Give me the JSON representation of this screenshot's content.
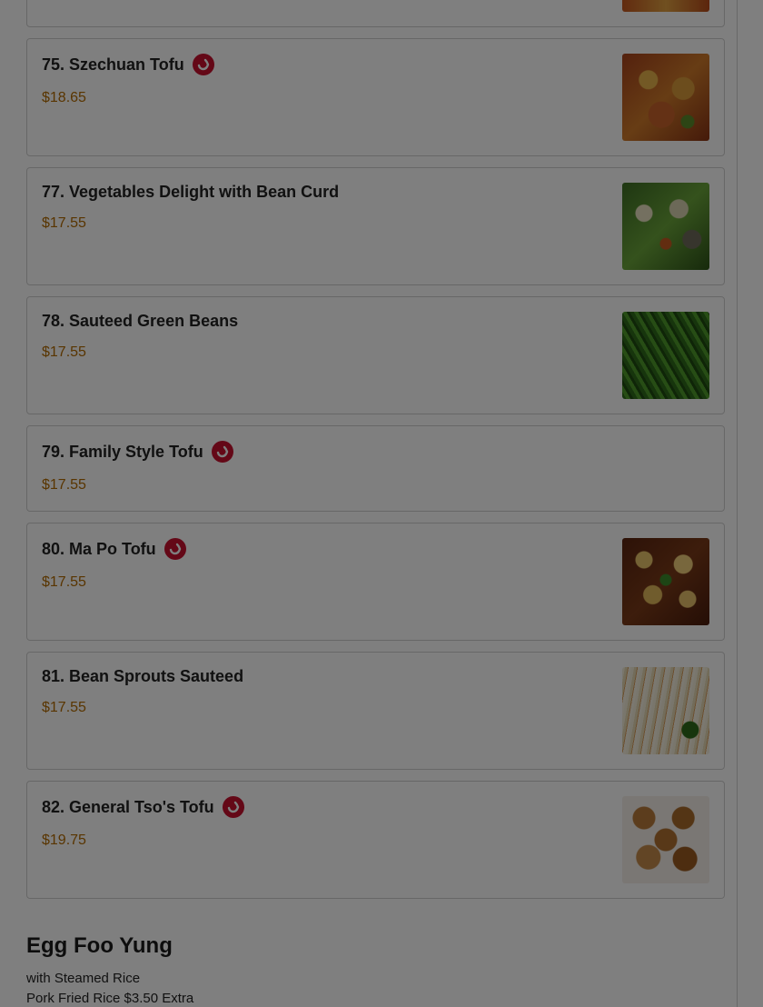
{
  "menu": {
    "items": [
      {
        "number_name": "75. Szechuan Tofu",
        "price": "$18.65",
        "spicy": true,
        "has_image": true,
        "food_icon": "stir-fry-tofu-photo"
      },
      {
        "number_name": "77. Vegetables Delight with Bean Curd",
        "price": "$17.55",
        "spicy": false,
        "has_image": true,
        "food_icon": "vegetables-photo"
      },
      {
        "number_name": "78. Sauteed Green Beans",
        "price": "$17.55",
        "spicy": false,
        "has_image": true,
        "food_icon": "green-beans-photo"
      },
      {
        "number_name": "79. Family Style Tofu",
        "price": "$17.55",
        "spicy": true,
        "has_image": false
      },
      {
        "number_name": "80. Ma Po Tofu",
        "price": "$17.55",
        "spicy": true,
        "has_image": true,
        "food_icon": "mapo-tofu-photo"
      },
      {
        "number_name": "81. Bean Sprouts Sauteed",
        "price": "$17.55",
        "spicy": false,
        "has_image": true,
        "food_icon": "bean-sprouts-photo"
      },
      {
        "number_name": "82. General Tso's Tofu",
        "price": "$19.75",
        "spicy": true,
        "has_image": true,
        "food_icon": "fried-tofu-photo"
      }
    ]
  },
  "section": {
    "title": "Egg Foo Yung",
    "line1": "with Steamed Rice",
    "line2": "Pork Fried Rice $3.50 Extra"
  },
  "colors": {
    "price": "#b36a00",
    "spicy_badge": "#c8102e",
    "overlay": "rgba(0,0,0,0.5)"
  }
}
